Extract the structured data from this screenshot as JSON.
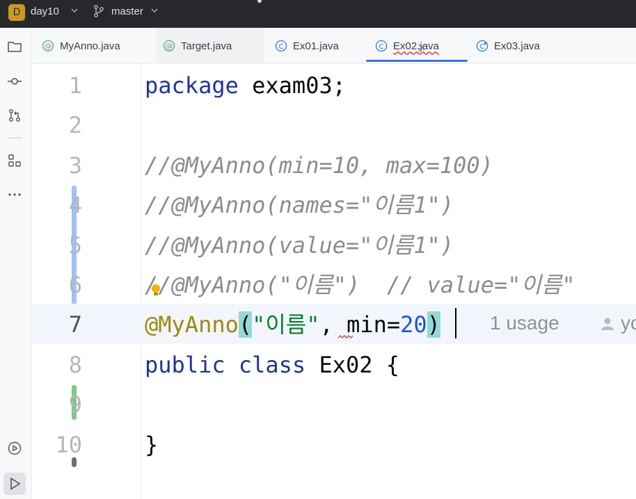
{
  "titlebar": {
    "project_badge": "D",
    "project_name": "day10",
    "branch_name": "master",
    "icons": [
      "chevron-down-icon",
      "git-branch-icon"
    ]
  },
  "toolstrip": {
    "icons": [
      "folder-icon",
      "commit-icon",
      "pull-requests-icon",
      "structure-icon",
      "more-icon",
      "services-icon",
      "run-icon"
    ]
  },
  "tabs": [
    {
      "label": "MyAnno.java",
      "icon": "annotation-icon"
    },
    {
      "label": "Target.java",
      "icon": "annotation-icon"
    },
    {
      "label": "Ex01.java",
      "icon": "class-icon"
    },
    {
      "label": "Ex02.java",
      "icon": "class-icon",
      "active": true
    },
    {
      "label": "Ex03.java",
      "icon": "runnable-class-icon"
    }
  ],
  "tab_close": "×",
  "editor": {
    "line_numbers": [
      "1",
      "2",
      "3",
      "4",
      "5",
      "6",
      "7",
      "8",
      "9",
      "10"
    ],
    "lines": {
      "l1_kw": "package",
      "l1_rest": " exam03;",
      "l3": "//@MyAnno(min=10, max=100)",
      "l4": "//@MyAnno(names=\"이름1\")",
      "l5": "//@MyAnno(value=\"이름1\")",
      "l6": "//@MyAnno(\"이름\")  // value=\"이름\"",
      "l7_anno": "@MyAnno",
      "l7_open": "(",
      "l7_str": "\"이름\"",
      "l7_mid": ", min=",
      "l7_num": "20",
      "l7_close": ")",
      "l8_kw1": "public",
      "l8_kw2": "class",
      "l8_rest": " Ex02 {",
      "l10": "}"
    },
    "inlay_usage": "1 usage",
    "inlay_author": "yo"
  },
  "colors": {
    "keyword": "#1e33a0",
    "comment": "#8c8c8c",
    "annotation": "#9e880d",
    "string": "#0a7e2e",
    "number": "#1750eb",
    "accent": "#3574f0"
  }
}
